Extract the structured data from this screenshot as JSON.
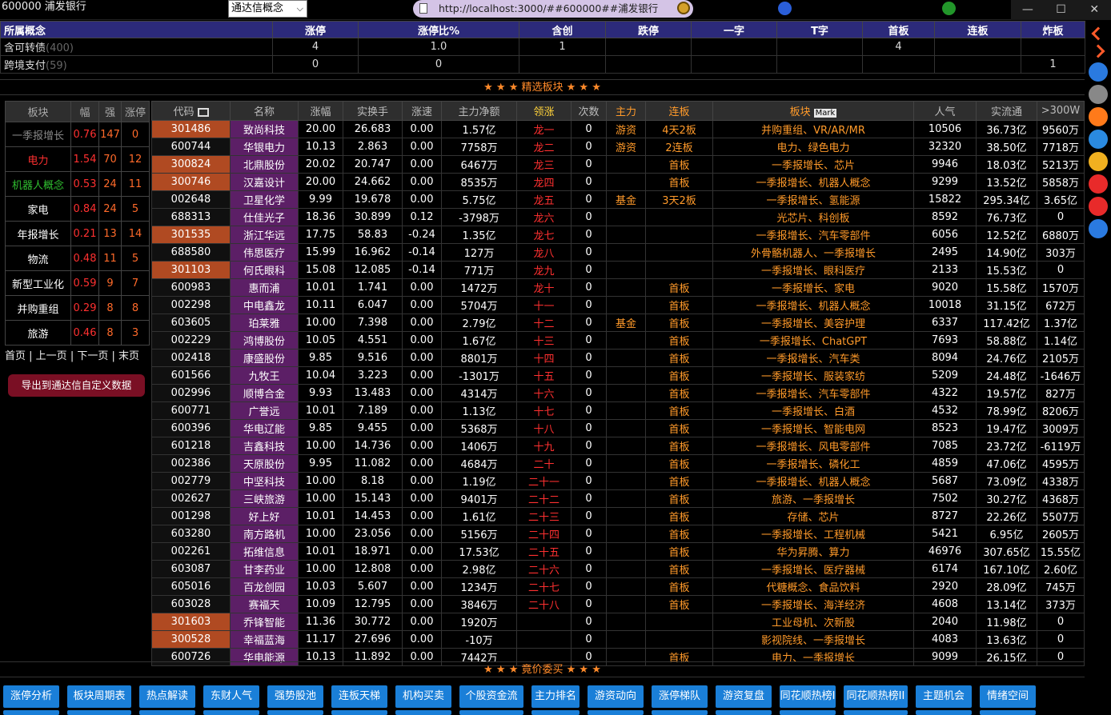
{
  "window": {
    "title": "600000 浦发银行",
    "min": "—",
    "max": "☐",
    "close": "✕"
  },
  "selector": {
    "value": "通达信概念"
  },
  "url": {
    "text": "http://localhost:3000/##600000##浦发银行"
  },
  "concept_table": {
    "headers": [
      "所属概念",
      "涨停",
      "涨停比%",
      "含创",
      "跌停",
      "一字",
      "T字",
      "首板",
      "连板",
      "炸板"
    ],
    "rows": [
      {
        "name": "含可转债",
        "count": "(400)",
        "zt": "4",
        "ratio": "1.0",
        "hc": "1",
        "dt": "",
        "yz": "",
        "tz": "",
        "sb": "4",
        "lb": "",
        "zb": ""
      },
      {
        "name": "跨境支付",
        "count": "(59)",
        "zt": "0",
        "ratio": "0",
        "hc": "",
        "dt": "",
        "yz": "",
        "tz": "",
        "sb": "",
        "lb": "",
        "zb": "1"
      }
    ]
  },
  "banner_top": "★ ★ ★ 精选板块 ★ ★ ★",
  "banner_bottom": "★ ★ ★ 竟价委买 ★ ★ ★",
  "sector_table": {
    "headers": [
      "板块",
      "幅",
      "强",
      "涨停"
    ],
    "rows": [
      {
        "name": "一季报增长",
        "color": "#888888",
        "fu": "0.76",
        "qiang": "147",
        "zt": "0"
      },
      {
        "name": "电力",
        "color": "#ff3030",
        "fu": "1.54",
        "qiang": "70",
        "zt": "12"
      },
      {
        "name": "机器人概念",
        "color": "#2fbf2f",
        "fu": "0.53",
        "qiang": "24",
        "zt": "11"
      },
      {
        "name": "家电",
        "color": "#ffffff",
        "fu": "0.84",
        "qiang": "24",
        "zt": "5"
      },
      {
        "name": "年报增长",
        "color": "#ffffff",
        "fu": "0.21",
        "qiang": "13",
        "zt": "14"
      },
      {
        "name": "物流",
        "color": "#ffffff",
        "fu": "0.48",
        "qiang": "11",
        "zt": "5"
      },
      {
        "name": "新型工业化",
        "color": "#ffffff",
        "fu": "0.59",
        "qiang": "9",
        "zt": "7"
      },
      {
        "name": "并购重组",
        "color": "#ffffff",
        "fu": "0.29",
        "qiang": "8",
        "zt": "8"
      },
      {
        "name": "旅游",
        "color": "#ffffff",
        "fu": "0.46",
        "qiang": "8",
        "zt": "3"
      }
    ]
  },
  "sector_nav": [
    "首页",
    "上一页",
    "下一页",
    "末页"
  ],
  "export_label": "导出到通达信自定义数据",
  "stock_table": {
    "headers": [
      "代码",
      "名称",
      "涨幅",
      "实换手",
      "涨速",
      "主力净额",
      "领涨",
      "次数",
      "主力",
      "连板",
      "板块",
      "人气",
      "实流通",
      ">300W"
    ],
    "mark_label": "Mark",
    "rows": [
      {
        "code": "301486",
        "hot": true,
        "name": "致尚科技",
        "chg": "20.00",
        "turn": "26.683",
        "spd": "0.00",
        "net": "1.57亿",
        "lead": "龙一",
        "cnt": "0",
        "zl": "游资",
        "lb": "4天2板",
        "bk": "并购重组、VR/AR/MR",
        "rq": "10506",
        "lt": "36.73亿",
        "big": "9560万"
      },
      {
        "code": "600744",
        "hot": false,
        "name": "华银电力",
        "chg": "10.13",
        "turn": "2.863",
        "spd": "0.00",
        "net": "7758万",
        "lead": "龙二",
        "cnt": "0",
        "zl": "游资",
        "lb": "2连板",
        "bk": "电力、绿色电力",
        "rq": "32320",
        "lt": "38.50亿",
        "big": "7718万"
      },
      {
        "code": "300824",
        "hot": true,
        "name": "北鼎股份",
        "chg": "20.02",
        "turn": "20.747",
        "spd": "0.00",
        "net": "6467万",
        "lead": "龙三",
        "cnt": "0",
        "zl": "",
        "lb": "首板",
        "bk": "一季报增长、芯片",
        "rq": "9946",
        "lt": "18.03亿",
        "big": "5213万"
      },
      {
        "code": "300746",
        "hot": true,
        "name": "汉嘉设计",
        "chg": "20.00",
        "turn": "24.662",
        "spd": "0.00",
        "net": "8535万",
        "lead": "龙四",
        "cnt": "0",
        "zl": "",
        "lb": "首板",
        "bk": "一季报增长、机器人概念",
        "rq": "9299",
        "lt": "13.52亿",
        "big": "5858万"
      },
      {
        "code": "002648",
        "hot": false,
        "name": "卫星化学",
        "chg": "9.99",
        "turn": "19.678",
        "spd": "0.00",
        "net": "5.75亿",
        "lead": "龙五",
        "cnt": "0",
        "zl": "基金",
        "lb": "3天2板",
        "bk": "一季报增长、氢能源",
        "rq": "15822",
        "lt": "295.34亿",
        "big": "3.65亿"
      },
      {
        "code": "688313",
        "hot": false,
        "name": "仕佳光子",
        "chg": "18.36",
        "turn": "30.899",
        "spd": "0.12",
        "net": "-3798万",
        "lead": "龙六",
        "cnt": "0",
        "zl": "",
        "lb": "",
        "bk": "光芯片、科创板",
        "rq": "8592",
        "lt": "76.73亿",
        "big": "0"
      },
      {
        "code": "301535",
        "hot": true,
        "name": "浙江华远",
        "chg": "17.75",
        "turn": "58.83",
        "spd": "-0.24",
        "net": "1.35亿",
        "lead": "龙七",
        "cnt": "0",
        "zl": "",
        "lb": "",
        "bk": "一季报增长、汽车零部件",
        "rq": "6056",
        "lt": "12.52亿",
        "big": "6880万"
      },
      {
        "code": "688580",
        "hot": false,
        "name": "伟思医疗",
        "chg": "15.99",
        "turn": "16.962",
        "spd": "-0.14",
        "net": "127万",
        "lead": "龙八",
        "cnt": "0",
        "zl": "",
        "lb": "",
        "bk": "外骨骼机器人、一季报增长",
        "rq": "2495",
        "lt": "14.90亿",
        "big": "303万"
      },
      {
        "code": "301103",
        "hot": true,
        "name": "何氏眼科",
        "chg": "15.08",
        "turn": "12.085",
        "spd": "-0.14",
        "net": "771万",
        "lead": "龙九",
        "cnt": "0",
        "zl": "",
        "lb": "",
        "bk": "一季报增长、眼科医疗",
        "rq": "2133",
        "lt": "15.53亿",
        "big": "0"
      },
      {
        "code": "600983",
        "hot": false,
        "name": "惠而浦",
        "chg": "10.01",
        "turn": "1.741",
        "spd": "0.00",
        "net": "1472万",
        "lead": "龙十",
        "cnt": "0",
        "zl": "",
        "lb": "首板",
        "bk": "一季报增长、家电",
        "rq": "9020",
        "lt": "15.58亿",
        "big": "1570万"
      },
      {
        "code": "002298",
        "hot": false,
        "name": "中电鑫龙",
        "chg": "10.11",
        "turn": "6.047",
        "spd": "0.00",
        "net": "5704万",
        "lead": "十一",
        "cnt": "0",
        "zl": "",
        "lb": "首板",
        "bk": "一季报增长、机器人概念",
        "rq": "10018",
        "lt": "31.15亿",
        "big": "672万"
      },
      {
        "code": "603605",
        "hot": false,
        "name": "珀莱雅",
        "chg": "10.00",
        "turn": "7.398",
        "spd": "0.00",
        "net": "2.79亿",
        "lead": "十二",
        "cnt": "0",
        "zl": "基金",
        "lb": "首板",
        "bk": "一季报增长、美容护理",
        "rq": "6337",
        "lt": "117.42亿",
        "big": "1.37亿"
      },
      {
        "code": "002229",
        "hot": false,
        "name": "鸿博股份",
        "chg": "10.05",
        "turn": "4.551",
        "spd": "0.00",
        "net": "1.67亿",
        "lead": "十三",
        "cnt": "0",
        "zl": "",
        "lb": "首板",
        "bk": "一季报增长、ChatGPT",
        "rq": "7693",
        "lt": "58.88亿",
        "big": "1.14亿"
      },
      {
        "code": "002418",
        "hot": false,
        "name": "康盛股份",
        "chg": "9.85",
        "turn": "9.516",
        "spd": "0.00",
        "net": "8801万",
        "lead": "十四",
        "cnt": "0",
        "zl": "",
        "lb": "首板",
        "bk": "一季报增长、汽车类",
        "rq": "8094",
        "lt": "24.76亿",
        "big": "2105万"
      },
      {
        "code": "601566",
        "hot": false,
        "name": "九牧王",
        "chg": "10.04",
        "turn": "3.223",
        "spd": "0.00",
        "net": "-1301万",
        "lead": "十五",
        "cnt": "0",
        "zl": "",
        "lb": "首板",
        "bk": "一季报增长、服装家纺",
        "rq": "5209",
        "lt": "24.48亿",
        "big": "-1646万"
      },
      {
        "code": "002996",
        "hot": false,
        "name": "顺博合金",
        "chg": "9.93",
        "turn": "13.483",
        "spd": "0.00",
        "net": "4314万",
        "lead": "十六",
        "cnt": "0",
        "zl": "",
        "lb": "首板",
        "bk": "一季报增长、汽车零部件",
        "rq": "4322",
        "lt": "19.57亿",
        "big": "827万"
      },
      {
        "code": "600771",
        "hot": false,
        "name": "广誉远",
        "chg": "10.01",
        "turn": "7.189",
        "spd": "0.00",
        "net": "1.13亿",
        "lead": "十七",
        "cnt": "0",
        "zl": "",
        "lb": "首板",
        "bk": "一季报增长、白酒",
        "rq": "4532",
        "lt": "78.99亿",
        "big": "8206万"
      },
      {
        "code": "600396",
        "hot": false,
        "name": "华电辽能",
        "chg": "9.85",
        "turn": "9.455",
        "spd": "0.00",
        "net": "5368万",
        "lead": "十八",
        "cnt": "0",
        "zl": "",
        "lb": "首板",
        "bk": "一季报增长、智能电网",
        "rq": "8523",
        "lt": "19.47亿",
        "big": "3009万"
      },
      {
        "code": "601218",
        "hot": false,
        "name": "吉鑫科技",
        "chg": "10.00",
        "turn": "14.736",
        "spd": "0.00",
        "net": "1406万",
        "lead": "十九",
        "cnt": "0",
        "zl": "",
        "lb": "首板",
        "bk": "一季报增长、风电零部件",
        "rq": "7085",
        "lt": "23.72亿",
        "big": "-6119万"
      },
      {
        "code": "002386",
        "hot": false,
        "name": "天原股份",
        "chg": "9.95",
        "turn": "11.082",
        "spd": "0.00",
        "net": "4684万",
        "lead": "二十",
        "cnt": "0",
        "zl": "",
        "lb": "首板",
        "bk": "一季报增长、磷化工",
        "rq": "4859",
        "lt": "47.06亿",
        "big": "4595万"
      },
      {
        "code": "002779",
        "hot": false,
        "name": "中坚科技",
        "chg": "10.00",
        "turn": "8.18",
        "spd": "0.00",
        "net": "1.19亿",
        "lead": "二十一",
        "cnt": "0",
        "zl": "",
        "lb": "首板",
        "bk": "一季报增长、机器人概念",
        "rq": "5687",
        "lt": "73.09亿",
        "big": "4338万"
      },
      {
        "code": "002627",
        "hot": false,
        "name": "三峡旅游",
        "chg": "10.00",
        "turn": "15.143",
        "spd": "0.00",
        "net": "9401万",
        "lead": "二十二",
        "cnt": "0",
        "zl": "",
        "lb": "首板",
        "bk": "旅游、一季报增长",
        "rq": "7502",
        "lt": "30.27亿",
        "big": "4368万"
      },
      {
        "code": "001298",
        "hot": false,
        "name": "好上好",
        "chg": "10.01",
        "turn": "14.453",
        "spd": "0.00",
        "net": "1.61亿",
        "lead": "二十三",
        "cnt": "0",
        "zl": "",
        "lb": "首板",
        "bk": "存储、芯片",
        "rq": "8727",
        "lt": "22.26亿",
        "big": "5507万"
      },
      {
        "code": "603280",
        "hot": false,
        "name": "南方路机",
        "chg": "10.00",
        "turn": "23.056",
        "spd": "0.00",
        "net": "5156万",
        "lead": "二十四",
        "cnt": "0",
        "zl": "",
        "lb": "首板",
        "bk": "一季报增长、工程机械",
        "rq": "5421",
        "lt": "6.95亿",
        "big": "2605万"
      },
      {
        "code": "002261",
        "hot": false,
        "name": "拓维信息",
        "chg": "10.01",
        "turn": "18.971",
        "spd": "0.00",
        "net": "17.53亿",
        "lead": "二十五",
        "cnt": "0",
        "zl": "",
        "lb": "首板",
        "bk": "华为昇腾、算力",
        "rq": "46976",
        "lt": "307.65亿",
        "big": "15.55亿"
      },
      {
        "code": "603087",
        "hot": false,
        "name": "甘李药业",
        "chg": "10.00",
        "turn": "12.808",
        "spd": "0.00",
        "net": "2.98亿",
        "lead": "二十六",
        "cnt": "0",
        "zl": "",
        "lb": "首板",
        "bk": "一季报增长、医疗器械",
        "rq": "6174",
        "lt": "167.10亿",
        "big": "2.60亿"
      },
      {
        "code": "605016",
        "hot": false,
        "name": "百龙创园",
        "chg": "10.03",
        "turn": "5.607",
        "spd": "0.00",
        "net": "1234万",
        "lead": "二十七",
        "cnt": "0",
        "zl": "",
        "lb": "首板",
        "bk": "代糖概念、食品饮料",
        "rq": "2920",
        "lt": "28.09亿",
        "big": "745万"
      },
      {
        "code": "603028",
        "hot": false,
        "name": "赛福天",
        "chg": "10.09",
        "turn": "12.795",
        "spd": "0.00",
        "net": "3846万",
        "lead": "二十八",
        "cnt": "0",
        "zl": "",
        "lb": "首板",
        "bk": "一季报增长、海洋经济",
        "rq": "4608",
        "lt": "13.14亿",
        "big": "373万"
      },
      {
        "code": "301603",
        "hot": true,
        "name": "乔锋智能",
        "chg": "11.36",
        "turn": "30.772",
        "spd": "0.00",
        "net": "1920万",
        "lead": "",
        "cnt": "0",
        "zl": "",
        "lb": "",
        "bk": "工业母机、次新股",
        "rq": "2040",
        "lt": "11.98亿",
        "big": "0"
      },
      {
        "code": "300528",
        "hot": true,
        "name": "幸福蓝海",
        "chg": "11.17",
        "turn": "27.696",
        "spd": "0.00",
        "net": "-10万",
        "lead": "",
        "cnt": "0",
        "zl": "",
        "lb": "",
        "bk": "影视院线、一季报增长",
        "rq": "4083",
        "lt": "13.63亿",
        "big": "0"
      },
      {
        "code": "600726",
        "hot": false,
        "name": "华电能源",
        "chg": "10.13",
        "turn": "11.892",
        "spd": "0.00",
        "net": "7442万",
        "lead": "",
        "cnt": "0",
        "zl": "",
        "lb": "首板",
        "bk": "电力、一季报增长",
        "rq": "9099",
        "lt": "26.15亿",
        "big": "0"
      }
    ]
  },
  "bottom_buttons": [
    "涨停分析",
    "板块周期表",
    "热点解读",
    "东财人气",
    "强势股池",
    "连板天梯",
    "机构买卖",
    "个股资金流",
    "主力排名",
    "游资动向",
    "涨停梯队",
    "游资复盘",
    "同花顺热榜I",
    "同花顺热榜II",
    "主题机会",
    "情绪空间"
  ],
  "sidebar_icons": [
    {
      "icon": "chevron-up-icon",
      "color": "#ff5a2a"
    },
    {
      "icon": "chevron-down-icon",
      "color": "#ff5a2a"
    },
    {
      "icon": "refresh-icon",
      "color": "#2a7ae0"
    },
    {
      "icon": "pin-icon",
      "color": "#888888"
    },
    {
      "icon": "bookmark-icon",
      "color": "#ff7a1a"
    },
    {
      "icon": "gear-icon",
      "color": "#2a8ae0"
    },
    {
      "icon": "folder-icon",
      "color": "#f0b020"
    },
    {
      "icon": "home-icon",
      "color": "#e82a2a"
    },
    {
      "icon": "star-icon",
      "color": "#e82a2a"
    },
    {
      "icon": "help-icon",
      "color": "#2a7ae0"
    }
  ]
}
